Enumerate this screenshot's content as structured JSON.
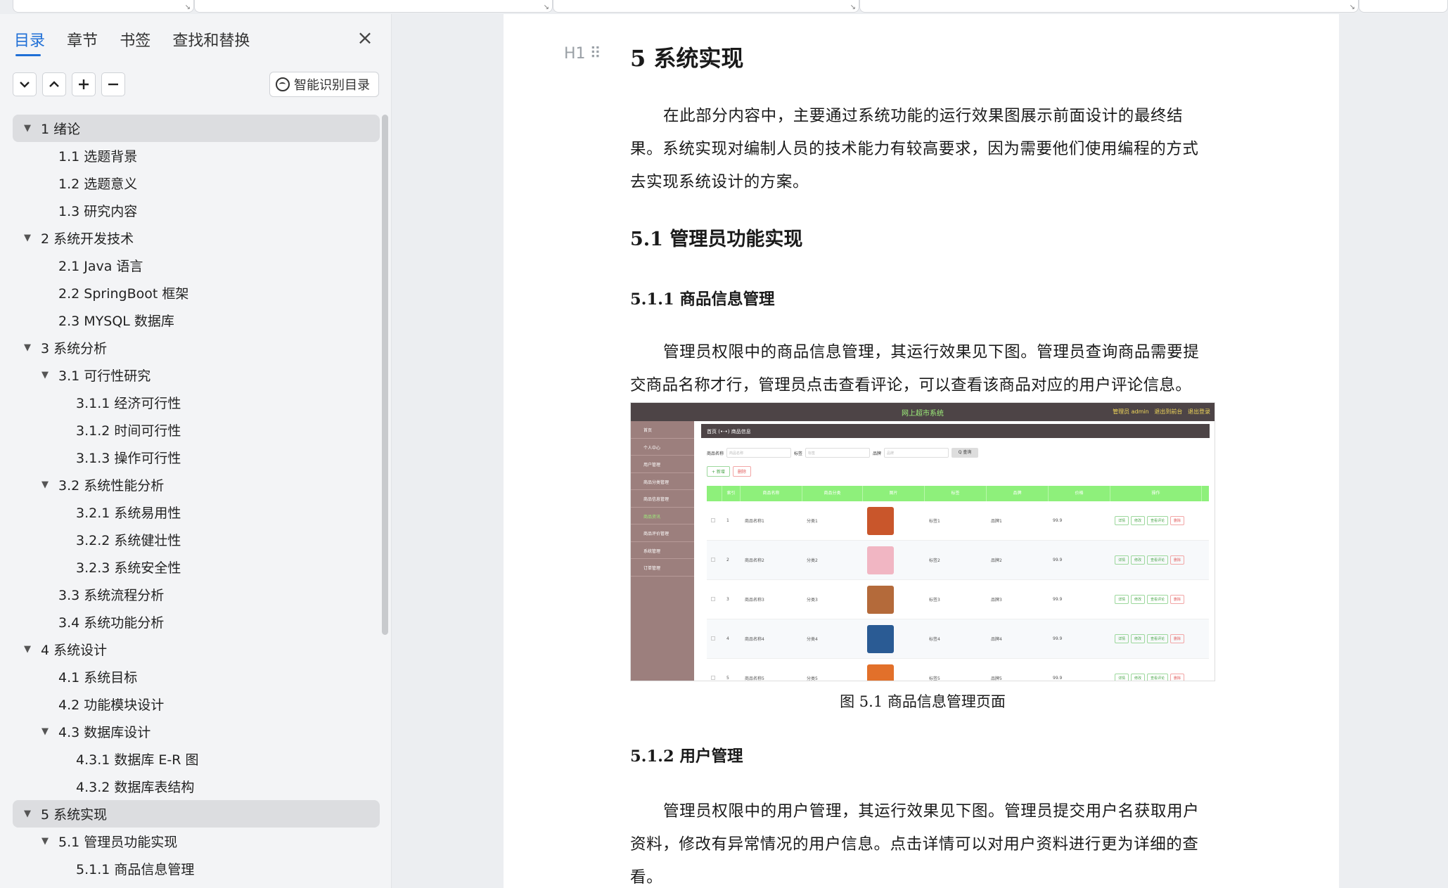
{
  "sidebar": {
    "tabs": [
      "目录",
      "章节",
      "书签",
      "查找和替换"
    ],
    "ai_button_label": "智能识别目录",
    "toc": [
      {
        "label": "1  绪论",
        "level": 1,
        "expanded": true,
        "highlighted": true
      },
      {
        "label": "1.1  选题背景",
        "level": 2
      },
      {
        "label": "1.2  选题意义",
        "level": 2
      },
      {
        "label": "1.3  研究内容",
        "level": 2
      },
      {
        "label": "2  系统开发技术",
        "level": 1,
        "expanded": true
      },
      {
        "label": "2.1 Java 语言",
        "level": 2
      },
      {
        "label": "2.2 SpringBoot 框架",
        "level": 2
      },
      {
        "label": "2.3 MYSQL 数据库",
        "level": 2
      },
      {
        "label": "3  系统分析",
        "level": 1,
        "expanded": true
      },
      {
        "label": "3.1 可行性研究",
        "level": 2,
        "expanded": true
      },
      {
        "label": "3.1.1 经济可行性",
        "level": 3
      },
      {
        "label": "3.1.2 时间可行性",
        "level": 3
      },
      {
        "label": "3.1.3 操作可行性",
        "level": 3
      },
      {
        "label": "3.2 系统性能分析",
        "level": 2,
        "expanded": true
      },
      {
        "label": "3.2.1 系统易用性",
        "level": 3
      },
      {
        "label": "3.2.2 系统健壮性",
        "level": 3
      },
      {
        "label": "3.2.3 系统安全性",
        "level": 3
      },
      {
        "label": "3.3  系统流程分析",
        "level": 2
      },
      {
        "label": "3.4 系统功能分析",
        "level": 2
      },
      {
        "label": "4  系统设计",
        "level": 1,
        "expanded": true
      },
      {
        "label": "4.1 系统目标",
        "level": 2
      },
      {
        "label": "4.2 功能模块设计",
        "level": 2
      },
      {
        "label": "4.3 数据库设计",
        "level": 2,
        "expanded": true
      },
      {
        "label": "4.3.1 数据库 E-R 图",
        "level": 3
      },
      {
        "label": "4.3.2  数据库表结构",
        "level": 3
      },
      {
        "label": "5  系统实现",
        "level": 1,
        "expanded": true,
        "highlighted": true
      },
      {
        "label": "5.1  管理员功能实现",
        "level": 2,
        "expanded": true
      },
      {
        "label": "5.1.1  商品信息管理",
        "level": 3
      }
    ]
  },
  "document": {
    "heading_handle": "H1",
    "h1": "5  系统实现",
    "intro_lines": [
      "在此部分内容中，主要通过系统功能的运行效果图展示前面设计的最终结",
      "果。系统实现对编制人员的技术能力有较高要求，因为需要他们使用编程的方式",
      "去实现系统设计的方案。"
    ],
    "h2": "5.1  管理员功能实现",
    "h3_1": "5.1.1  商品信息管理",
    "para2_lines": [
      "管理员权限中的商品信息管理，其运行效果见下图。管理员查询商品需要提",
      "交商品名称才行，管理员点击查看评论，可以查看该商品对应的用户评论信息。"
    ],
    "figure_caption": "图 5.1  商品信息管理页面",
    "h3_2": "5.1.2  用户管理",
    "para3_lines": [
      "管理员权限中的用户管理，其运行效果见下图。管理员提交用户名获取用户",
      "资料，修改有异常情况的用户信息。点击详情可以对用户资料进行更为详细的查",
      "看。"
    ]
  },
  "screenshot": {
    "title": "网上超市系统",
    "top_right": [
      "管理员 admin",
      "退出到前台",
      "退出登录"
    ],
    "side_items": [
      "首页",
      "个人中心",
      "用户管理",
      "商品分类管理",
      "商品信息管理",
      "商品资讯",
      "商品评价管理",
      "系统管理",
      "订单管理"
    ],
    "crumb": "首页  (•-•)  商品信息",
    "search_labels": [
      "商品名称",
      "标签",
      "品牌"
    ],
    "search_placeholders": [
      "商品名称",
      "标签",
      "品牌"
    ],
    "search_button": "Q 查询",
    "add_button": "+ 新增",
    "delete_button": "删除",
    "columns": [
      "",
      "索引",
      "商品名称",
      "商品分类",
      "图片",
      "标签",
      "品牌",
      "价格",
      "操作"
    ],
    "rows": [
      {
        "idx": "1",
        "name": "商品名称1",
        "cat": "分类1",
        "tag": "标签1",
        "brand": "品牌1",
        "price": "99.9",
        "color": "#c9562b"
      },
      {
        "idx": "2",
        "name": "商品名称2",
        "cat": "分类2",
        "tag": "标签2",
        "brand": "品牌2",
        "price": "99.9",
        "color": "#f1b6c3"
      },
      {
        "idx": "3",
        "name": "商品名称3",
        "cat": "分类3",
        "tag": "标签3",
        "brand": "品牌3",
        "price": "99.9",
        "color": "#b46a3a"
      },
      {
        "idx": "4",
        "name": "商品名称4",
        "cat": "分类4",
        "tag": "标签4",
        "brand": "品牌4",
        "price": "99.9",
        "color": "#2a5b94"
      },
      {
        "idx": "5",
        "name": "商品名称5",
        "cat": "分类5",
        "tag": "标签5",
        "brand": "品牌5",
        "price": "99.9",
        "color": "#e2702a"
      }
    ],
    "op_labels": [
      "详情",
      "修改",
      "查看评论",
      "删除"
    ]
  }
}
